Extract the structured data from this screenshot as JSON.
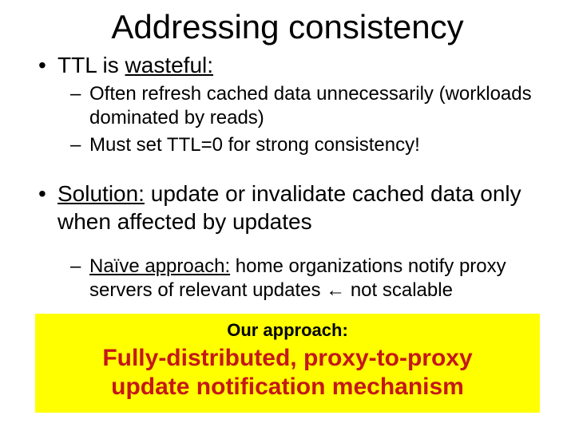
{
  "title": "Addressing consistency",
  "b1_pre": "TTL is ",
  "b1_u": "wasteful:",
  "b1_a": "Often refresh cached data unnecessarily (workloads dominated by reads)",
  "b1_b": "Must set TTL=0 for strong consistency!",
  "b2_u": "Solution:",
  "b2_post": " update or invalidate cached data only when affected by updates",
  "b2_a_u": "Naïve approach:",
  "b2_a_post": " home organizations notify proxy servers of relevant updates  ← not scalable",
  "callout_lead": "Our approach:",
  "callout_main_l1": "Fully-distributed, proxy-to-proxy",
  "callout_main_l2": "update notification mechanism"
}
